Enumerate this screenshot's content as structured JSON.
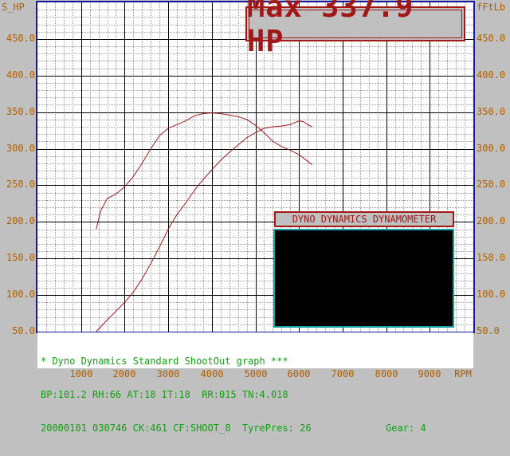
{
  "chart_data": {
    "type": "line",
    "y_left_label": "S_HP",
    "y_right_label": "fFtLb",
    "x_unit_label": "RPM",
    "xlim": [
      0,
      10000
    ],
    "ylim": [
      50,
      500
    ],
    "y_ticks": [
      "450.0",
      "400.0",
      "350.0",
      "300.0",
      "250.0",
      "200.0",
      "150.0",
      "100.0",
      "50.0"
    ],
    "x_ticks": [
      "1000",
      "2000",
      "3000",
      "4000",
      "5000",
      "6000",
      "7000",
      "8000",
      "9000"
    ],
    "x_tick_values": [
      1000,
      2000,
      3000,
      4000,
      5000,
      6000,
      7000,
      8000,
      9000
    ],
    "y_tick_values": [
      450,
      400,
      350,
      300,
      250,
      200,
      150,
      100,
      50
    ],
    "grid": true,
    "series": [
      {
        "values": [
          [
            1350,
            190
          ],
          [
            1450,
            215
          ],
          [
            1600,
            232
          ],
          [
            1800,
            238
          ],
          [
            2000,
            248
          ],
          [
            2200,
            262
          ],
          [
            2400,
            280
          ],
          [
            2600,
            300
          ],
          [
            2800,
            318
          ],
          [
            3000,
            328
          ],
          [
            3200,
            333
          ],
          [
            3400,
            338
          ],
          [
            3600,
            345
          ],
          [
            3800,
            348
          ],
          [
            4000,
            349
          ],
          [
            4200,
            348
          ],
          [
            4400,
            346
          ],
          [
            4600,
            344
          ],
          [
            4800,
            340
          ],
          [
            5000,
            332
          ],
          [
            5200,
            322
          ],
          [
            5400,
            310
          ],
          [
            5600,
            303
          ],
          [
            5800,
            298
          ],
          [
            6000,
            292
          ],
          [
            6200,
            283
          ],
          [
            6300,
            278
          ]
        ],
        "color": "#a01818"
      },
      {
        "values": [
          [
            1350,
            50
          ],
          [
            1550,
            63
          ],
          [
            1800,
            78
          ],
          [
            2000,
            90
          ],
          [
            2200,
            104
          ],
          [
            2400,
            122
          ],
          [
            2600,
            143
          ],
          [
            2800,
            166
          ],
          [
            3000,
            190
          ],
          [
            3200,
            210
          ],
          [
            3400,
            226
          ],
          [
            3600,
            243
          ],
          [
            3800,
            258
          ],
          [
            4000,
            271
          ],
          [
            4200,
            284
          ],
          [
            4400,
            295
          ],
          [
            4600,
            305
          ],
          [
            4800,
            315
          ],
          [
            5000,
            322
          ],
          [
            5200,
            328
          ],
          [
            5400,
            330
          ],
          [
            5600,
            331
          ],
          [
            5800,
            333
          ],
          [
            6000,
            338
          ],
          [
            6100,
            337
          ],
          [
            6200,
            333
          ],
          [
            6300,
            330
          ]
        ],
        "color": "#a01818"
      }
    ]
  },
  "header": {
    "max_text": "Max 337.9 HP"
  },
  "overlay": {
    "title": "DYNO DYNAMICS DYNAMOMETER"
  },
  "info": {
    "line1": "* Dyno Dynamics Standard ShootOut graph ***",
    "line2": "BP:101.2 RH:66 AT:18 IT:18  RR:015 TN:4.018",
    "line3_left": "20000101 030746 CK:461 CF:SHOOT_8  TyrePres: 26",
    "line3_right": "Gear: 4"
  },
  "colors": {
    "background": "#c0c0c0",
    "plot_bg": "#ffffff",
    "grid_minor": "#9a9a9a",
    "grid_major": "#000000",
    "frame": "#1818a0",
    "axis_text": "#b06000",
    "curve": "#a01818",
    "info_text": "#10a010"
  }
}
